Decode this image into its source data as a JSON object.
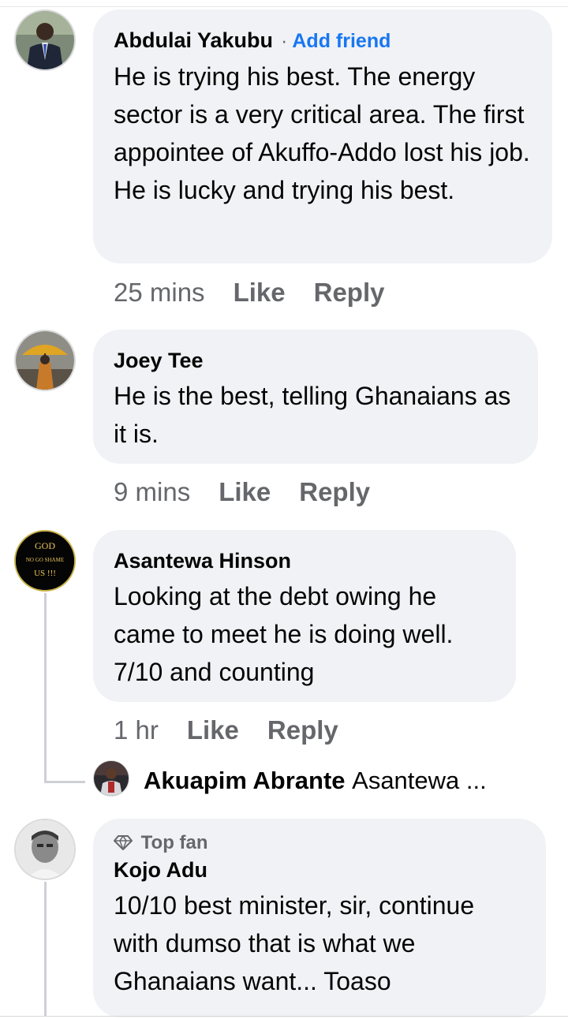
{
  "comments": [
    {
      "author": "Abdulai Yakubu",
      "separator": "·",
      "add_friend": "Add friend",
      "text": "He is trying his best. The energy sector is a very critical area. The first appointee of Akuffo-Addo lost his job. He is lucky and trying his best.",
      "time": "25 mins",
      "like": "Like",
      "reply": "Reply"
    },
    {
      "author": "Joey Tee",
      "text": "He is the best, telling Ghanaians as it is.",
      "time": "9 mins",
      "like": "Like",
      "reply": "Reply"
    },
    {
      "author": "Asantewa Hinson",
      "avatar_text": [
        "GOD",
        "NO GO SHAME",
        "US !!!"
      ],
      "text": "Looking at the debt owing he came to meet he is doing well. 7/10 and counting",
      "time": "1 hr",
      "like": "Like",
      "reply": "Reply",
      "reply_preview": {
        "author": "Akuapim Abrante",
        "text": "Asantewa ..."
      }
    },
    {
      "badge": "Top fan",
      "author": "Kojo Adu",
      "text": "10/10 best minister, sir, continue with dumso that is what we Ghanaians want... Toaso"
    }
  ],
  "colors": {
    "bubble": "#f0f2f5",
    "link": "#1877f2",
    "meta": "#65676b",
    "text": "#050505"
  }
}
